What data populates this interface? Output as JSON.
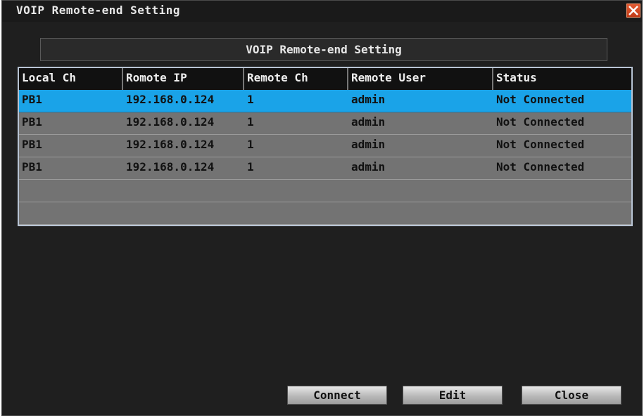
{
  "window": {
    "title": "VOIP Remote-end Setting",
    "close_icon": "close-icon"
  },
  "panel": {
    "header": "VOIP Remote-end Setting"
  },
  "table": {
    "columns": [
      "Local Ch",
      "Romote IP",
      "Remote Ch",
      "Remote User",
      "Status"
    ],
    "rows": [
      {
        "local_ch": "PB1",
        "remote_ip": "192.168.0.124",
        "remote_ch": "1",
        "remote_user": "admin",
        "status": "Not Connected",
        "selected": true
      },
      {
        "local_ch": "PB1",
        "remote_ip": "192.168.0.124",
        "remote_ch": "1",
        "remote_user": "admin",
        "status": "Not Connected",
        "selected": false
      },
      {
        "local_ch": "PB1",
        "remote_ip": "192.168.0.124",
        "remote_ch": "1",
        "remote_user": "admin",
        "status": "Not Connected",
        "selected": false
      },
      {
        "local_ch": "PB1",
        "remote_ip": "192.168.0.124",
        "remote_ch": "1",
        "remote_user": "admin",
        "status": "Not Connected",
        "selected": false
      },
      {
        "local_ch": "",
        "remote_ip": "",
        "remote_ch": "",
        "remote_user": "",
        "status": "",
        "selected": false
      },
      {
        "local_ch": "",
        "remote_ip": "",
        "remote_ch": "",
        "remote_user": "",
        "status": "",
        "selected": false
      }
    ]
  },
  "buttons": {
    "connect": "Connect",
    "edit": "Edit",
    "close": "Close"
  },
  "colors": {
    "window_bg": "#1f1f1f",
    "row_bg": "#737373",
    "selected_row": "#1aa3e8",
    "header_bg": "#111111",
    "close_button": "#d9482a"
  }
}
